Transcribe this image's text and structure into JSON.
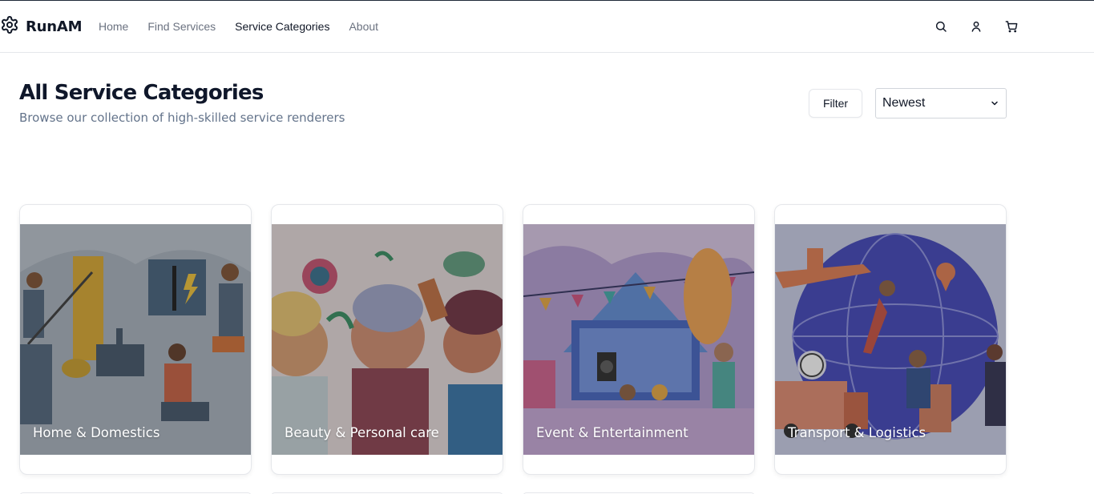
{
  "brand": {
    "name": "RunAM",
    "icon": "gear-icon"
  },
  "nav": {
    "links": [
      "Home",
      "Find Services",
      "Service Categories",
      "About"
    ],
    "active": "Service Categories",
    "icons": [
      "search-icon",
      "user-icon",
      "cart-icon"
    ]
  },
  "heading": {
    "title": "All Service Categories",
    "subtitle": "Browse our collection of high-skilled service renderers"
  },
  "controls": {
    "filter_label": "Filter",
    "sort_selected": "Newest"
  },
  "categories": [
    {
      "label": "Home & Domestics"
    },
    {
      "label": "Beauty & Personal care"
    },
    {
      "label": "Event & Entertainment"
    },
    {
      "label": "Transport & Logistics"
    }
  ]
}
